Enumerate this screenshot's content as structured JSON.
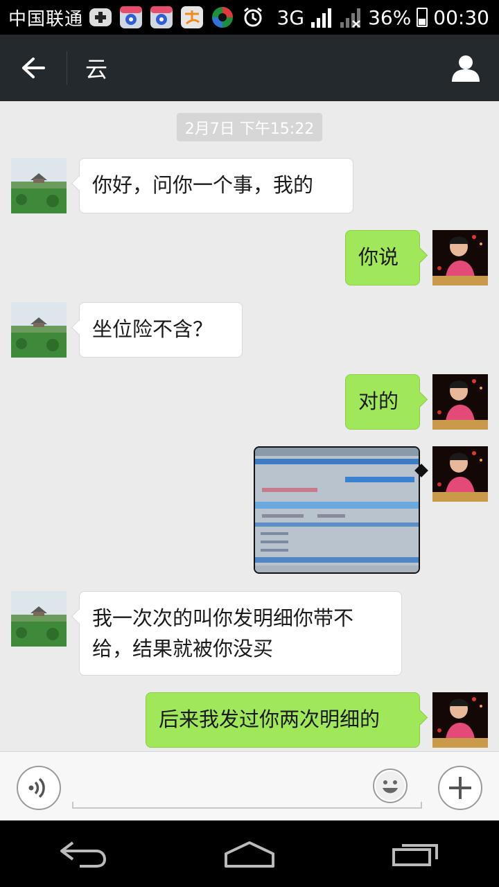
{
  "status_bar": {
    "carrier": "中国联通",
    "network": "3G",
    "battery": "36%",
    "time": "00:30",
    "icons": [
      "plus-square-icon",
      "paw-app-icon",
      "paw-app-icon",
      "alipay-icon",
      "music-app-icon",
      "alarm-icon",
      "signal-icon",
      "no-signal-icon"
    ]
  },
  "header": {
    "title": "云",
    "back_icon": "arrow-left-icon",
    "contact_icon": "person-icon"
  },
  "chat": {
    "timestamp": "2月7日 下午15:22",
    "messages": [
      {
        "side": "in",
        "text": "你好，问你一个事，我的"
      },
      {
        "side": "out",
        "text": "你说"
      },
      {
        "side": "in",
        "text": "坐位险不含？"
      },
      {
        "side": "out",
        "text": "对的"
      },
      {
        "side": "out",
        "type": "image"
      },
      {
        "side": "in",
        "text": "我一次次的叫你发明细你带不给，结果就被你没买"
      },
      {
        "side": "out",
        "text": "后来我发过你两次明细的"
      }
    ]
  },
  "input_bar": {
    "voice_icon": "voice-icon",
    "emoji_icon": "emoji-icon",
    "more_icon": "plus-icon",
    "input_value": ""
  },
  "nav_bar": {
    "icons": [
      "back-nav-icon",
      "home-nav-icon",
      "recents-nav-icon"
    ]
  },
  "colors": {
    "outgoing_bubble": "#a0e75a",
    "incoming_bubble": "#ffffff",
    "header_bg": "#23292c",
    "chat_bg": "#ebebeb"
  }
}
